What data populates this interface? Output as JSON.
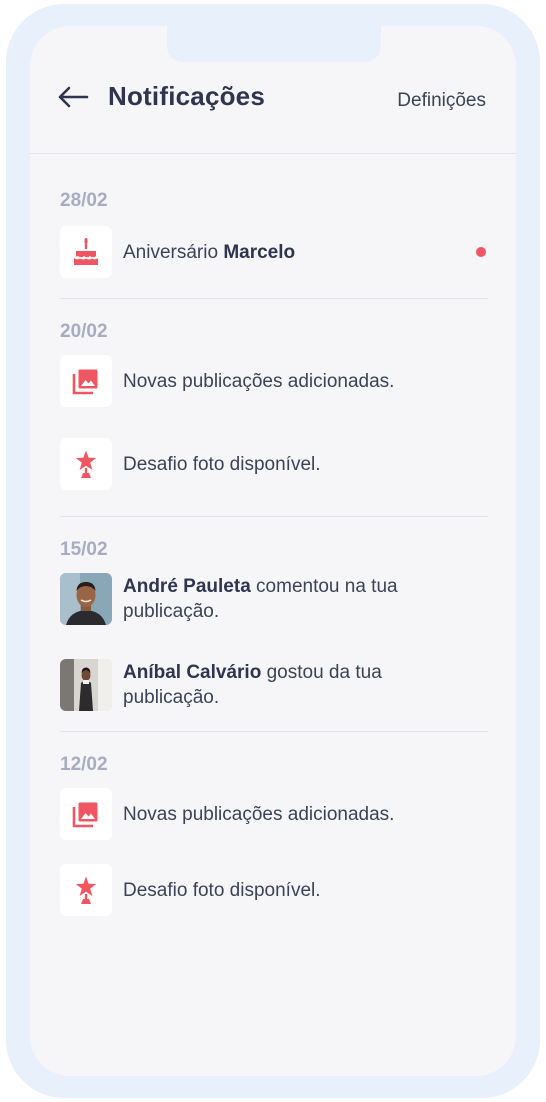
{
  "header": {
    "title": "Notificações",
    "settings_label": "Definições"
  },
  "colors": {
    "accent": "#ef5662",
    "text": "#2f3550",
    "muted": "#a8abc3"
  },
  "groups": [
    {
      "date": "28/02",
      "items": [
        {
          "icon": "birthday-cake-icon",
          "prefix": "Aniversário ",
          "bold": "Marcelo",
          "suffix": "",
          "unread": true
        }
      ]
    },
    {
      "date": "20/02",
      "items": [
        {
          "icon": "photo-library-icon",
          "text": "Novas publicações adicionadas."
        },
        {
          "icon": "star-trophy-icon",
          "text": "Desafio foto disponível."
        }
      ]
    },
    {
      "date": "15/02",
      "items": [
        {
          "icon": "avatar",
          "bold": "André Pauleta",
          "suffix": " comentou na tua publicação."
        },
        {
          "icon": "avatar",
          "bold": "Aníbal Calvário",
          "suffix": " gostou da tua publicação."
        }
      ]
    },
    {
      "date": "12/02",
      "items": [
        {
          "icon": "photo-library-icon",
          "text": "Novas publicações adicionadas."
        },
        {
          "icon": "star-trophy-icon",
          "text": "Desafio foto disponível."
        }
      ]
    }
  ]
}
